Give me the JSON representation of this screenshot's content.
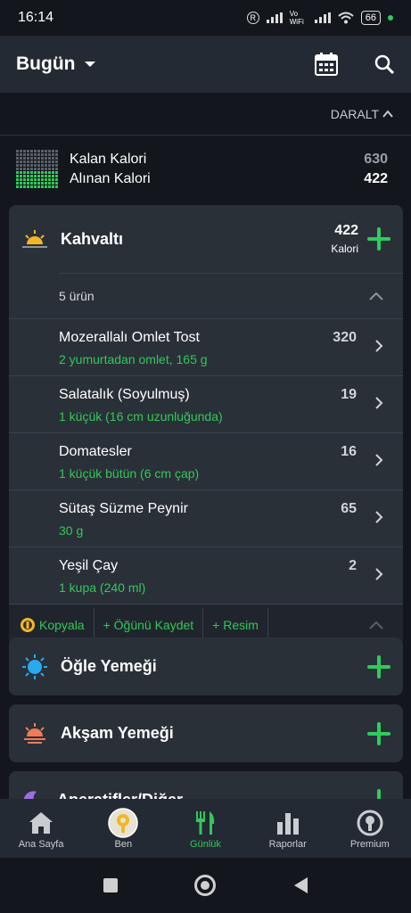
{
  "status": {
    "time": "16:14",
    "battery": "66",
    "volte": "Vo WiFi"
  },
  "header": {
    "title": "Bugün"
  },
  "collapse_label": "DARALT",
  "summary": {
    "remaining_label": "Kalan Kalori",
    "remaining_value": "630",
    "consumed_label": "Alınan Kalori",
    "consumed_value": "422"
  },
  "breakfast": {
    "name": "Kahvaltı",
    "calories": "422",
    "calories_label": "Kalori",
    "count": "5 ürün",
    "items": [
      {
        "name": "Mozerallalı Omlet Tost",
        "portion": "2 yumurtadan omlet, 165 g",
        "cal": "320"
      },
      {
        "name": "Salatalık (Soyulmuş)",
        "portion": "1 küçük (16 cm uzunluğunda)",
        "cal": "19"
      },
      {
        "name": "Domatesler",
        "portion": "1 küçük bütün (6 cm çap)",
        "cal": "16"
      },
      {
        "name": "Sütaş Süzme Peynir",
        "portion": "30 g",
        "cal": "65"
      },
      {
        "name": "Yeşil Çay",
        "portion": "1 kupa (240 ml)",
        "cal": "2"
      }
    ],
    "actions": {
      "copy": "Kopyala",
      "save": "+ Öğünü Kaydet",
      "photo": "+ Resim"
    }
  },
  "lunch": {
    "name": "Öğle Yemeği"
  },
  "dinner": {
    "name": "Akşam Yemeği"
  },
  "snacks": {
    "name": "Aperatifler/Diğer"
  },
  "nav": {
    "home": "Ana Sayfa",
    "me": "Ben",
    "diary": "Günlük",
    "reports": "Raporlar",
    "premium": "Premium"
  },
  "colors": {
    "accent": "#32c85a",
    "card": "#2a3038",
    "background": "#13171d"
  }
}
